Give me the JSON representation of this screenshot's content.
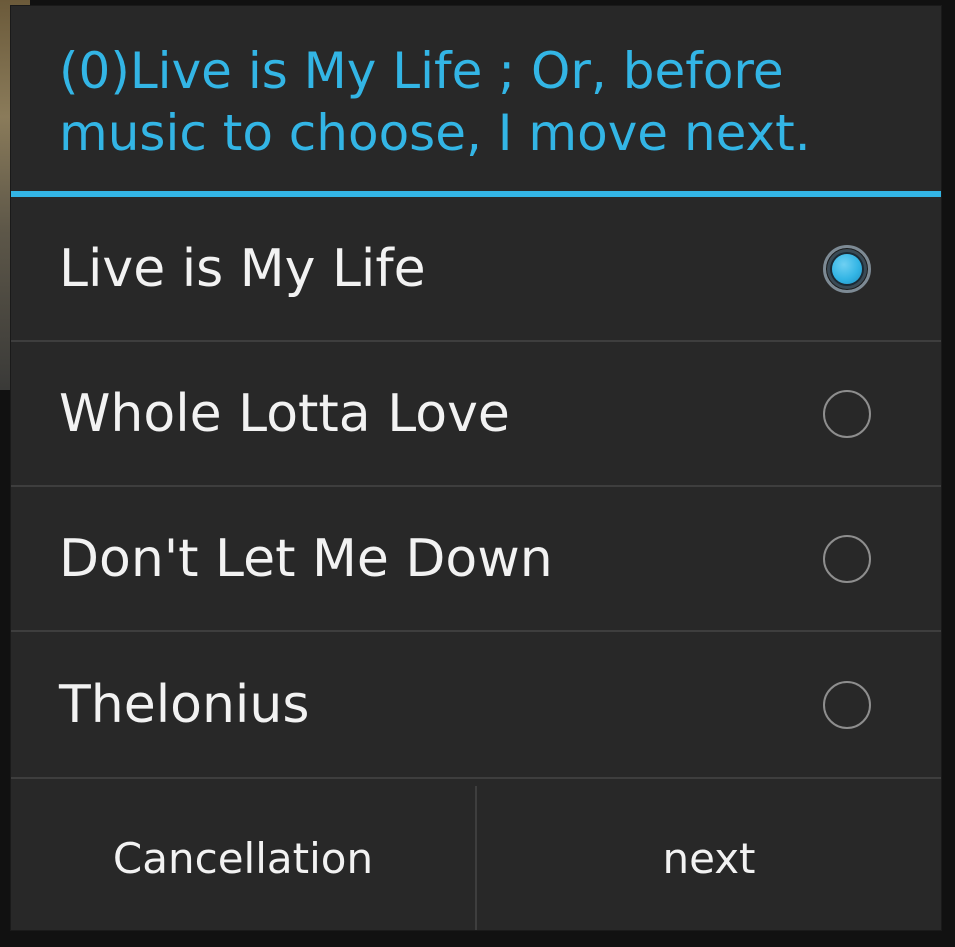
{
  "dialog": {
    "title": "(0)Live is My Life ; Or, before music to choose, I move next.",
    "options": [
      {
        "label": "Live is My Life",
        "checked": true
      },
      {
        "label": "Whole Lotta Love",
        "checked": false
      },
      {
        "label": "Don't Let Me Down",
        "checked": false
      },
      {
        "label": "Thelonius",
        "checked": false
      }
    ],
    "buttons": {
      "cancel": "Cancellation",
      "next": "next"
    }
  },
  "colors": {
    "accent": "#33b5e5",
    "dialog_bg": "#282828",
    "text": "#f2f2f2",
    "divider": "#3e3e3e"
  },
  "icons": {
    "selected_radio": "radio-checked-icon",
    "unselected_radio": "radio-unchecked-icon"
  }
}
